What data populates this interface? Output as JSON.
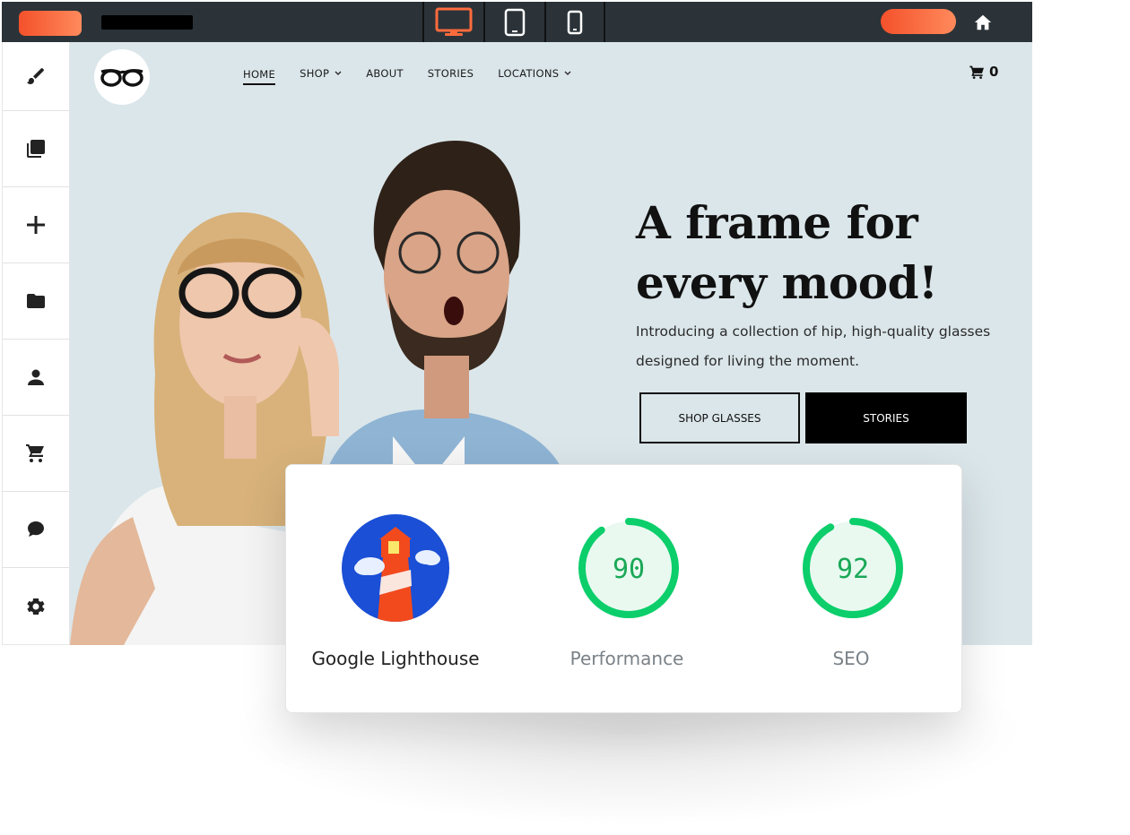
{
  "toolbar": {
    "devices": [
      "desktop",
      "tablet",
      "mobile"
    ],
    "active_device": "desktop",
    "accent": "#f4512b",
    "background": "#2b3338"
  },
  "sidebar": {
    "items": [
      "brush-icon",
      "pages-icon",
      "add-icon",
      "folder-icon",
      "user-icon",
      "cart-icon",
      "chat-icon",
      "gear-icon"
    ]
  },
  "site": {
    "nav": {
      "home": "HOME",
      "shop": "SHOP",
      "about": "ABOUT",
      "stories": "STORIES",
      "locations": "LOCATIONS"
    },
    "cart_count": "0",
    "hero": {
      "headline_line1": "A frame for",
      "headline_line2": "every mood!",
      "sub_line1": "Introducing a collection of hip, high-quality glasses",
      "sub_line2": "designed for living the moment.",
      "shop_button": "SHOP GLASSES",
      "stories_button": "STORIES"
    },
    "background": "#dbe6ea"
  },
  "lighthouse": {
    "title": "Google Lighthouse",
    "metrics": [
      {
        "label": "Performance",
        "score": "90",
        "value": 90
      },
      {
        "label": "SEO",
        "score": "92",
        "value": 92
      }
    ],
    "gauge_color": "#0cce6b",
    "gauge_fill": "#e9f9f0"
  }
}
